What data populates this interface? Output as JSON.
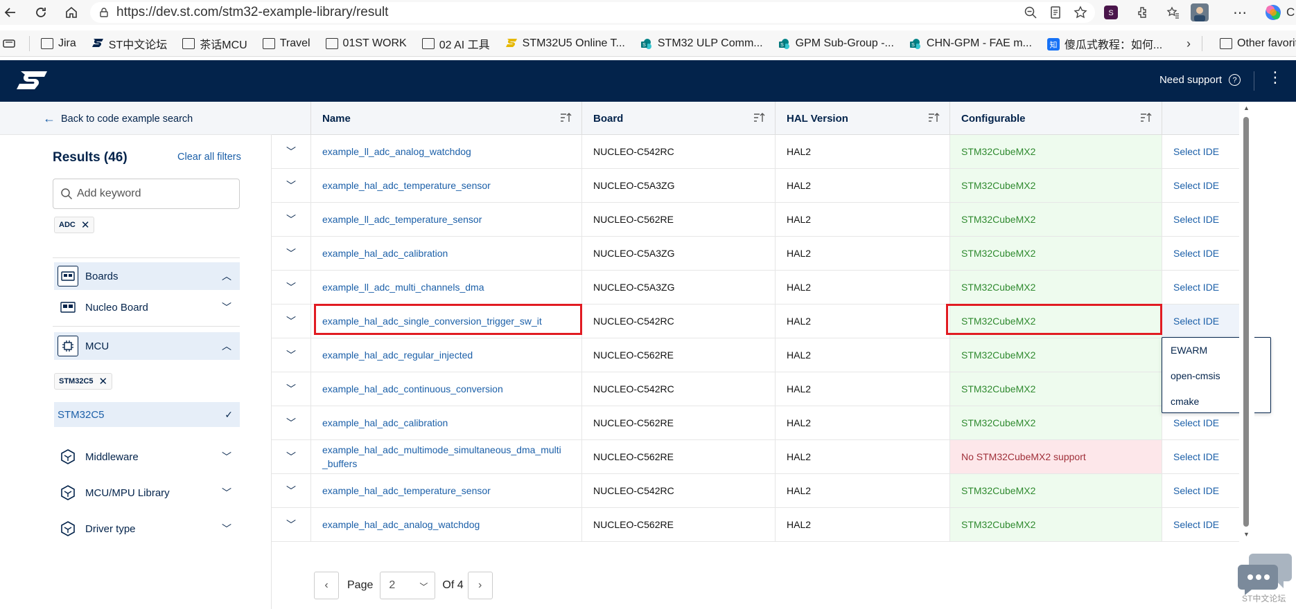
{
  "browser": {
    "url": "https://dev.st.com/stm32-example-library/result",
    "profile_initial": "C"
  },
  "bookmarks": [
    {
      "label": "Jira",
      "icon": "folder"
    },
    {
      "label": "ST中文论坛",
      "icon": "st-logo"
    },
    {
      "label": "茶话MCU",
      "icon": "folder"
    },
    {
      "label": "Travel",
      "icon": "folder"
    },
    {
      "label": "01ST WORK",
      "icon": "folder"
    },
    {
      "label": "02 AI 工具",
      "icon": "folder"
    },
    {
      "label": "STM32U5 Online T...",
      "icon": "st-logo"
    },
    {
      "label": "STM32 ULP Comm...",
      "icon": "sharepoint"
    },
    {
      "label": "GPM Sub-Group -...",
      "icon": "sharepoint"
    },
    {
      "label": "CHN-GPM - FAE m...",
      "icon": "sharepoint"
    },
    {
      "label": "傻瓜式教程：如何...",
      "icon": "zhihu"
    }
  ],
  "bookmarks_other": "Other favorites",
  "header": {
    "need_support": "Need support",
    "help_glyph": "?"
  },
  "sidebar": {
    "back_label": "Back to code example search",
    "results_title": "Results (46)",
    "clear_all": "Clear all filters",
    "keyword_placeholder": "Add keyword",
    "chips": {
      "adc": "ADC",
      "stm32c5": "STM32C5"
    },
    "filters": {
      "boards": "Boards",
      "nucleo_board": "Nucleo Board",
      "mcu": "MCU",
      "stm32c5": "STM32C5",
      "middleware": "Middleware",
      "mcu_mpu_library": "MCU/MPU Library",
      "driver_type": "Driver type"
    }
  },
  "table": {
    "headers": {
      "name": "Name",
      "board": "Board",
      "hal": "HAL Version",
      "configurable": "Configurable"
    },
    "rows": [
      {
        "name": "example_ll_adc_analog_watchdog",
        "board": "NUCLEO-C542RC",
        "hal": "HAL2",
        "configurable": "STM32CubeMX2",
        "cfg_ok": true,
        "ide": "Select IDE"
      },
      {
        "name": "example_hal_adc_temperature_sensor",
        "board": "NUCLEO-C5A3ZG",
        "hal": "HAL2",
        "configurable": "STM32CubeMX2",
        "cfg_ok": true,
        "ide": "Select IDE"
      },
      {
        "name": "example_ll_adc_temperature_sensor",
        "board": "NUCLEO-C562RE",
        "hal": "HAL2",
        "configurable": "STM32CubeMX2",
        "cfg_ok": true,
        "ide": "Select IDE"
      },
      {
        "name": "example_hal_adc_calibration",
        "board": "NUCLEO-C5A3ZG",
        "hal": "HAL2",
        "configurable": "STM32CubeMX2",
        "cfg_ok": true,
        "ide": "Select IDE"
      },
      {
        "name": "example_ll_adc_multi_channels_dma",
        "board": "NUCLEO-C5A3ZG",
        "hal": "HAL2",
        "configurable": "STM32CubeMX2",
        "cfg_ok": true,
        "ide": "Select IDE"
      },
      {
        "name": "example_hal_adc_single_conversion_trigger_sw_it",
        "board": "NUCLEO-C542RC",
        "hal": "HAL2",
        "configurable": "STM32CubeMX2",
        "cfg_ok": true,
        "ide": "Select IDE"
      },
      {
        "name": "example_hal_adc_regular_injected",
        "board": "NUCLEO-C562RE",
        "hal": "HAL2",
        "configurable": "STM32CubeMX2",
        "cfg_ok": true,
        "ide": "Select IDE"
      },
      {
        "name": "example_hal_adc_continuous_conversion",
        "board": "NUCLEO-C542RC",
        "hal": "HAL2",
        "configurable": "STM32CubeMX2",
        "cfg_ok": true,
        "ide": "Select IDE"
      },
      {
        "name": "example_hal_adc_calibration",
        "board": "NUCLEO-C562RE",
        "hal": "HAL2",
        "configurable": "STM32CubeMX2",
        "cfg_ok": true,
        "ide": "Select IDE"
      },
      {
        "name": "example_hal_adc_multimode_simultaneous_dma_multi\n_buffers",
        "board": "NUCLEO-C562RE",
        "hal": "HAL2",
        "configurable": "No STM32CubeMX2 support",
        "cfg_ok": false,
        "ide": "Select IDE"
      },
      {
        "name": "example_hal_adc_temperature_sensor",
        "board": "NUCLEO-C542RC",
        "hal": "HAL2",
        "configurable": "STM32CubeMX2",
        "cfg_ok": true,
        "ide": "Select IDE"
      },
      {
        "name": "example_hal_adc_analog_watchdog",
        "board": "NUCLEO-C562RE",
        "hal": "HAL2",
        "configurable": "STM32CubeMX2",
        "cfg_ok": true,
        "ide": "Select IDE"
      }
    ]
  },
  "ide_dropdown": [
    "EWARM",
    "open-cmsis",
    "cmake"
  ],
  "pager": {
    "page_label": "Page",
    "current_page": "2",
    "of_label": "Of 4"
  },
  "forum_label": "ST中文论坛",
  "colors": {
    "st_navy": "#03234b",
    "link_blue": "#1b5fa8",
    "highlight_red": "#e11b22",
    "ok_green": "#2f8a2f",
    "no_support_red": "#a0303a"
  }
}
